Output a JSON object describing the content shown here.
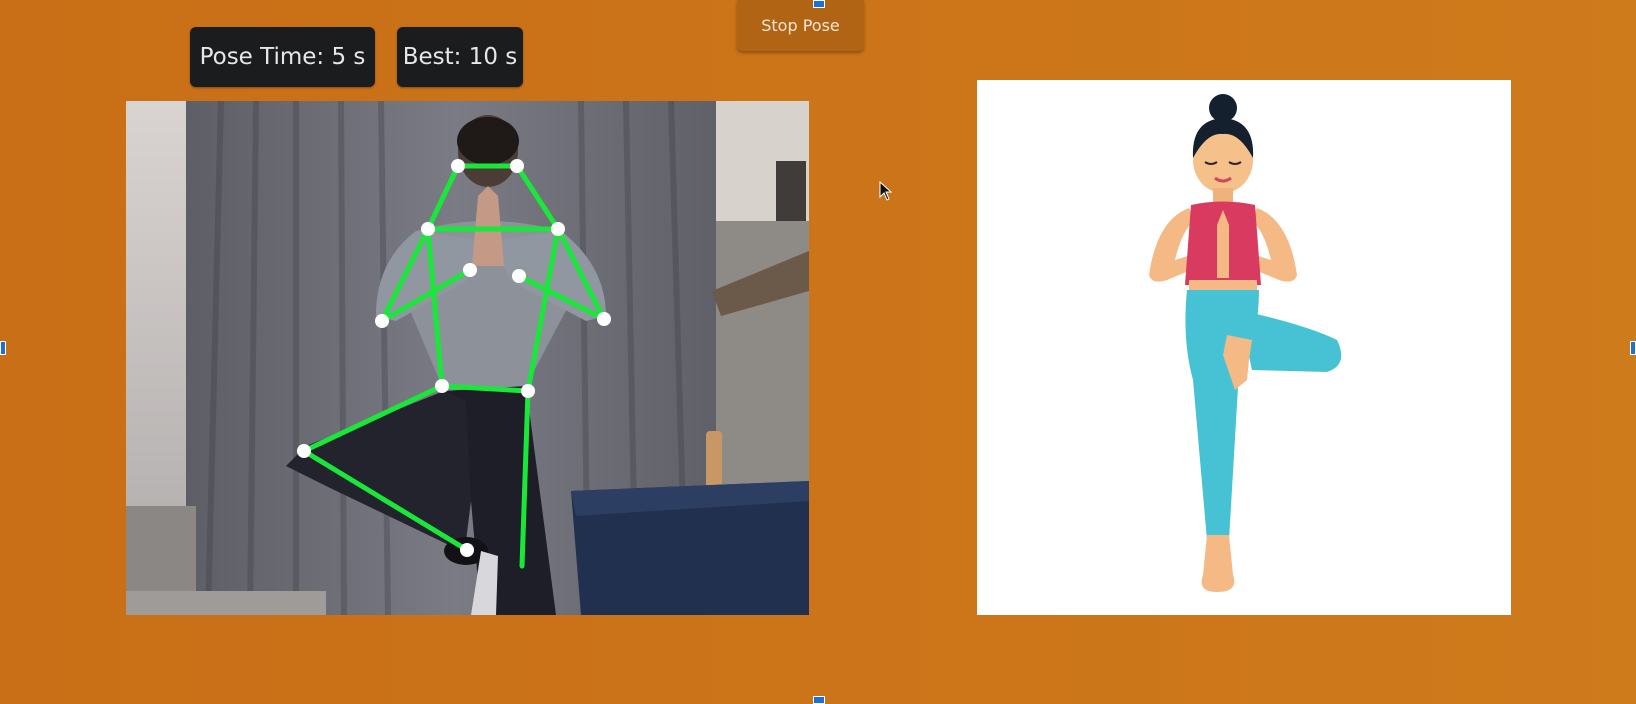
{
  "stats": {
    "pose_time": "Pose Time: 5 s",
    "best": "Best: 10 s"
  },
  "controls": {
    "stop_label": "Stop Pose"
  },
  "colors": {
    "background": "#cc7519",
    "pill_bg": "#1b1c1e",
    "skeleton": "#19e83a",
    "keypoint": "#ffffff",
    "button_bg": "#b06414"
  },
  "reference_pose": {
    "icon": "tree-pose-illustration"
  }
}
